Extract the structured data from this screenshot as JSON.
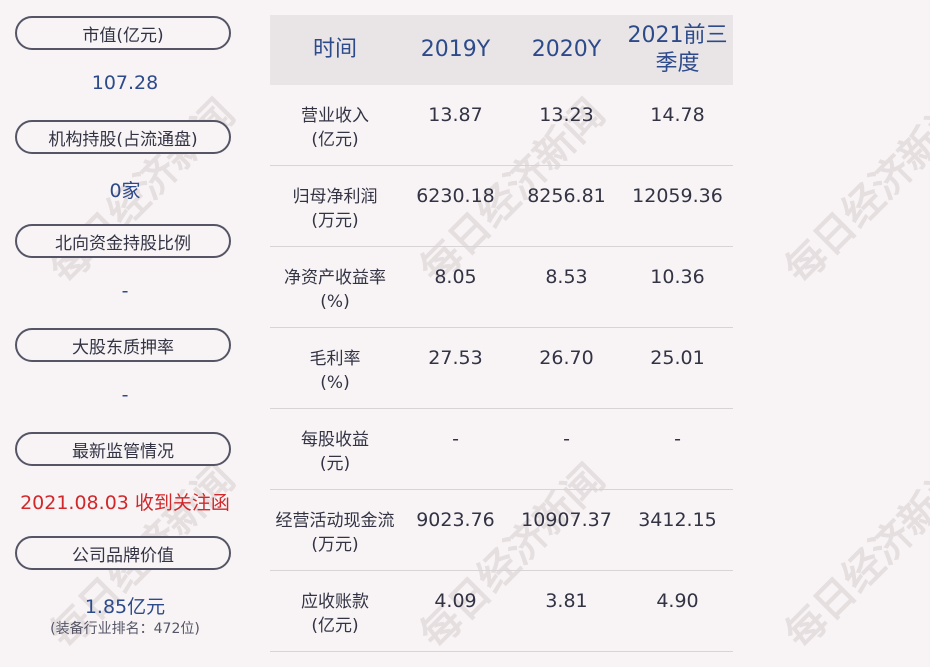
{
  "left": {
    "market_cap_label": "市值(亿元)",
    "market_cap_value": "107.28",
    "institution_label": "机构持股(占流通盘)",
    "institution_value": "0家",
    "northbound_label": "北向资金持股比例",
    "northbound_value": "-",
    "pledge_label": "大股东质押率",
    "pledge_value": "-",
    "regulation_label": "最新监管情况",
    "regulation_value": "2021.08.03 收到关注函",
    "brand_label": "公司品牌价值",
    "brand_value": "1.85亿元",
    "brand_rank": "(装备行业排名：472位)"
  },
  "table": {
    "headers": [
      "时间",
      "2019Y",
      "2020Y",
      "2021前三季度"
    ],
    "rows": [
      {
        "label": [
          "营业收入",
          "(亿元)"
        ],
        "values": [
          "13.87",
          "13.23",
          "14.78"
        ]
      },
      {
        "label": [
          "归母净利润",
          "(万元)"
        ],
        "values": [
          "6230.18",
          "8256.81",
          "12059.36"
        ]
      },
      {
        "label": [
          "净资产收益率",
          "(%)"
        ],
        "values": [
          "8.05",
          "8.53",
          "10.36"
        ]
      },
      {
        "label": [
          "毛利率",
          "(%)"
        ],
        "values": [
          "27.53",
          "26.70",
          "25.01"
        ]
      },
      {
        "label": [
          "每股收益",
          "(元)"
        ],
        "values": [
          "-",
          "-",
          "-"
        ]
      },
      {
        "label": [
          "经营活动现金流",
          "(万元)"
        ],
        "values": [
          "9023.76",
          "10907.37",
          "3412.15"
        ]
      },
      {
        "label": [
          "应收账款",
          "(亿元)"
        ],
        "values": [
          "4.09",
          "3.81",
          "4.90"
        ]
      }
    ]
  },
  "watermark": "每日经济新闻"
}
